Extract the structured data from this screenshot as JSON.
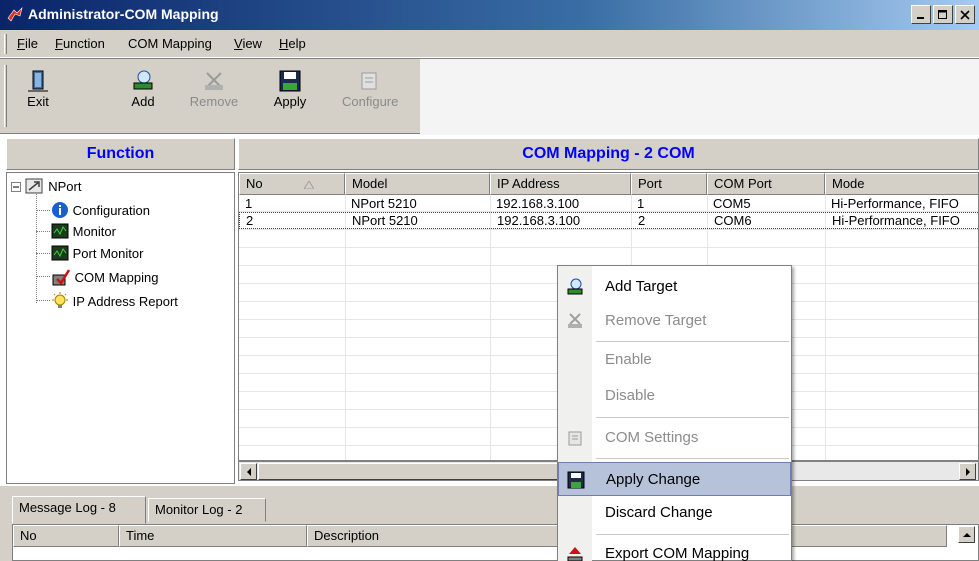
{
  "window": {
    "title": "Administrator-COM Mapping"
  },
  "menu": [
    "File",
    "Function",
    "COM Mapping",
    "View",
    "Help"
  ],
  "toolbar": {
    "exit": "Exit",
    "add": "Add",
    "remove": "Remove",
    "apply": "Apply",
    "configure": "Configure"
  },
  "function_panel": {
    "header": "Function",
    "root": "NPort",
    "items": [
      "Configuration",
      "Monitor",
      "Port Monitor",
      "COM Mapping",
      "IP Address Report"
    ]
  },
  "com_panel": {
    "header": "COM Mapping - 2 COM",
    "columns": [
      "No",
      "Model",
      "IP Address",
      "Port",
      "COM Port",
      "Mode"
    ],
    "rows": [
      [
        "1",
        "NPort 5210",
        "192.168.3.100",
        "1",
        "COM5",
        "Hi-Performance, FIFO"
      ],
      [
        "2",
        "NPort 5210",
        "192.168.3.100",
        "2",
        "COM6",
        "Hi-Performance, FIFO"
      ]
    ]
  },
  "log": {
    "tabs": [
      "Message Log - 8",
      "Monitor Log - 2"
    ],
    "columns": [
      "No",
      "Time",
      "Description"
    ]
  },
  "context_menu": {
    "items": [
      {
        "label": "Add Target",
        "enabled": true,
        "icon": "add-target-icon"
      },
      {
        "label": "Remove Target",
        "enabled": false,
        "icon": "remove-target-icon"
      },
      {
        "label": "Enable",
        "enabled": false,
        "icon": ""
      },
      {
        "label": "Disable",
        "enabled": false,
        "icon": ""
      },
      {
        "label": "COM Settings",
        "enabled": false,
        "icon": "com-settings-icon"
      },
      {
        "label": "Apply Change",
        "enabled": true,
        "icon": "save-icon",
        "highlighted": true
      },
      {
        "label": "Discard Change",
        "enabled": true,
        "icon": ""
      },
      {
        "label": "Export COM Mapping",
        "enabled": true,
        "icon": "export-icon"
      }
    ]
  },
  "colors": {
    "header_text": "#0000ff",
    "chrome": "#d4d0c8",
    "highlight": "#b6c2d9"
  }
}
